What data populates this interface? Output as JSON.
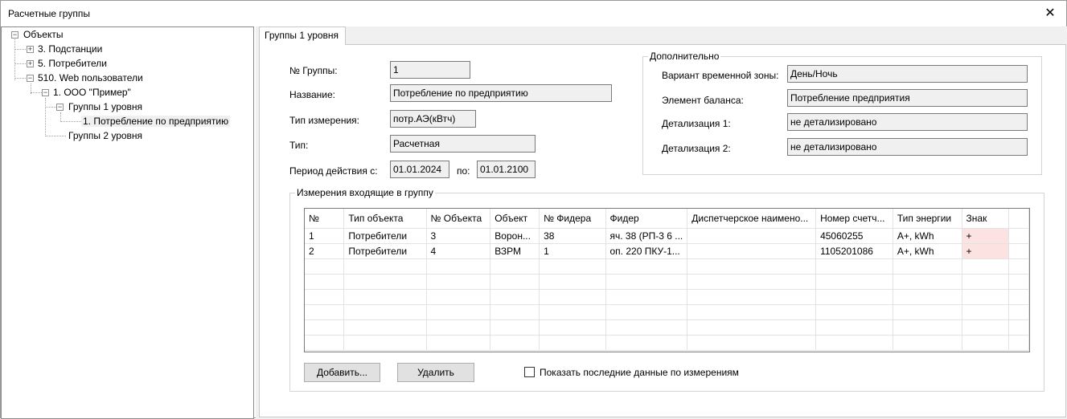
{
  "window": {
    "title": "Расчетные группы",
    "close_glyph": "✕"
  },
  "tree": {
    "root": "Объекты",
    "n1": "3. Подстанции",
    "n2": "5. Потребители",
    "n3": "510. Web пользователи",
    "n31": "1. ООО \"Пример\"",
    "n311": "Группы 1 уровня",
    "n3111": "1. Потребление по предприятию",
    "n312": "Группы 2 уровня",
    "expanded_glyph": "−",
    "collapsed_glyph": "+"
  },
  "tab": {
    "label": "Группы 1 уровня"
  },
  "form": {
    "group_no_label": "№ Группы:",
    "group_no": "1",
    "name_label": "Название:",
    "name": "Потребление по предприятию",
    "meas_type_label": "Тип измерения:",
    "meas_type": "потр.АЭ(кВтч)",
    "type_label": "Тип:",
    "type": "Расчетная",
    "period_label": "Период действия с:",
    "period_from": "01.01.2024",
    "period_to_label": "по:",
    "period_to": "01.01.2100"
  },
  "extra": {
    "legend": "Дополнительно",
    "tz_label": "Вариант временной зоны:",
    "tz": "День/Ночь",
    "balance_label": "Элемент баланса:",
    "balance": "Потребление предприятия",
    "det1_label": "Детализация 1:",
    "det1": "не детализировано",
    "det2_label": "Детализация 2:",
    "det2": "не детализировано"
  },
  "measurements": {
    "legend": "Измерения входящие в группу",
    "columns": [
      "№",
      "Тип объекта",
      "№ Объекта",
      "Объект",
      "№ Фидера",
      "Фидер",
      "Диспетчерское наимено...",
      "Номер счетч...",
      "Тип энергии",
      "Знак"
    ],
    "rows": [
      [
        "1",
        "Потребители",
        "3",
        "Ворон...",
        "38",
        "яч. 38 (РП-3 6 ...",
        "",
        "45060255",
        "A+, kWh",
        "+"
      ],
      [
        "2",
        "Потребители",
        "4",
        "ВЗРМ",
        "1",
        "оп. 220 ПКУ-1...",
        "",
        "1105201086",
        "A+, kWh",
        "+"
      ]
    ],
    "add_button": "Добавить...",
    "delete_button": "Удалить",
    "show_last_label": "Показать последние данные по измерениям"
  }
}
